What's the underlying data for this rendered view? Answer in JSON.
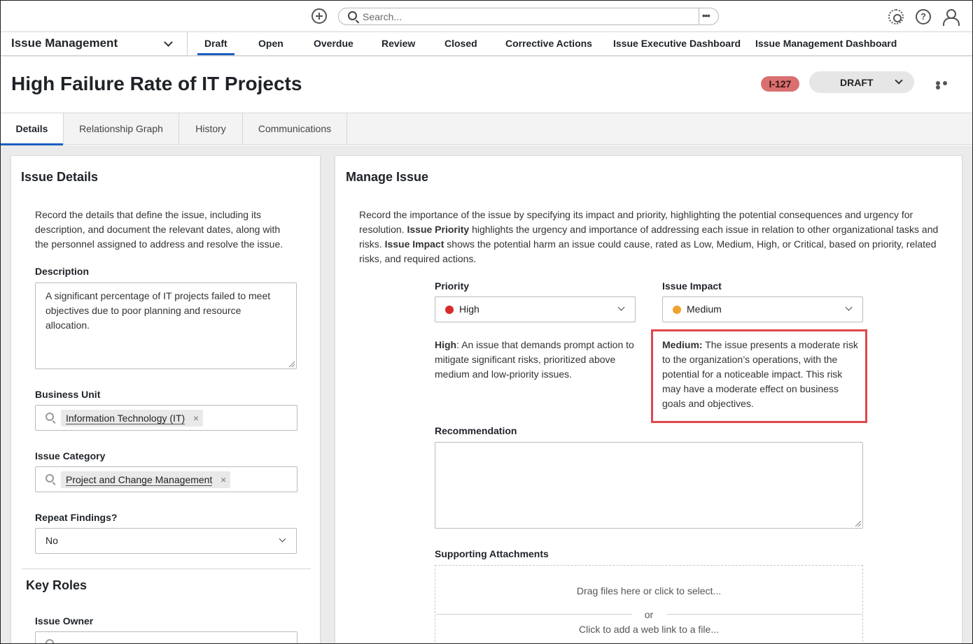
{
  "topbar": {
    "search_placeholder": "Search...",
    "more_label": "•••",
    "help_label": "?"
  },
  "nav": {
    "app_name": "Issue Management",
    "tabs": [
      "Draft",
      "Open",
      "Overdue",
      "Review",
      "Closed",
      "Corrective Actions",
      "Issue Executive Dashboard",
      "Issue Management Dashboard"
    ],
    "active_tab": "Draft"
  },
  "header": {
    "title": "High Failure Rate of IT Projects",
    "id_badge": "I-127",
    "status": "DRAFT",
    "badge_color": "#d9706f"
  },
  "tabs": {
    "items": [
      "Details",
      "Relationship Graph",
      "History",
      "Communications"
    ],
    "active": "Details"
  },
  "issue_details": {
    "title": "Issue Details",
    "intro": "Record the details that define the issue, including its description, and document the relevant dates, along with the personnel assigned to address and resolve the issue.",
    "description_label": "Description",
    "description_value": "A significant percentage of IT projects failed to meet objectives due to poor planning and resource allocation.",
    "business_unit_label": "Business Unit",
    "business_unit_value": "Information Technology (IT)",
    "issue_category_label": "Issue Category",
    "issue_category_value": "Project and Change Management",
    "repeat_findings_label": "Repeat Findings?",
    "repeat_findings_value": "No",
    "key_roles_title": "Key Roles",
    "issue_owner_label": "Issue Owner"
  },
  "manage_issue": {
    "title": "Manage Issue",
    "intro_part1": "Record the importance of the issue by specifying its impact and priority, highlighting the potential consequences and urgency for resolution. ",
    "intro_bold1": "Issue Priority",
    "intro_part2": " highlights the urgency and importance of addressing each issue in relation to other organizational tasks and risks. ",
    "intro_bold2": "Issue Impact",
    "intro_part3": " shows the potential harm an issue could cause, rated as Low, Medium, High, or Critical, based on priority, related risks, and required actions.",
    "priority_label": "Priority",
    "priority_value": "High",
    "priority_color": "#d92b2b",
    "impact_label": "Issue Impact",
    "impact_value": "Medium",
    "impact_color": "#f0a22e",
    "priority_desc_bold": "High",
    "priority_desc": ": An issue that demands prompt action to mitigate significant risks, prioritized above medium and low-priority issues.",
    "impact_desc_bold": "Medium:",
    "impact_desc": " The issue presents a moderate risk to the organization’s operations, with the potential for a noticeable impact. This risk may have a moderate effect on business goals and objectives.",
    "recommendation_label": "Recommendation",
    "attachments_label": "Supporting Attachments",
    "drag_text": "Drag files here or click to select...",
    "or_text": "or",
    "link_text": "Click to add a web link to a file..."
  },
  "colors": {
    "accent": "#1b5fbf",
    "highlight_border": "#e0474c"
  }
}
